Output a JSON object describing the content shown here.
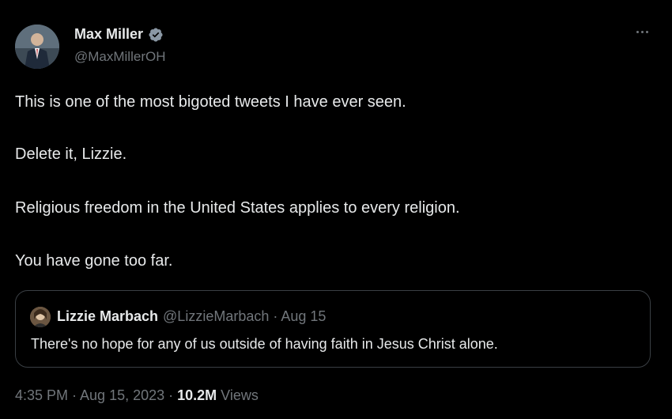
{
  "author": {
    "display_name": "Max Miller",
    "handle": "@MaxMillerOH",
    "verified": true
  },
  "tweet": {
    "paragraphs": [
      "This is one of the most bigoted tweets I have ever seen.",
      "Delete it, Lizzie.",
      "Religious freedom in the United States applies to every religion.",
      "You have gone too far."
    ]
  },
  "quoted_tweet": {
    "display_name": "Lizzie Marbach",
    "handle_and_date": "@LizzieMarbach · Aug 15",
    "text": "There's no hope for any of us outside of having faith in Jesus Christ alone."
  },
  "footer": {
    "timestamp": "4:35 PM · Aug 15, 2023 ·",
    "views_count": "10.2M",
    "views_label": "Views"
  },
  "colors": {
    "background": "#000000",
    "primary_text": "#e7e9ea",
    "secondary_text": "#71767b",
    "verified_badge": "#8b98a5"
  },
  "icons": {
    "verified": "verified-badge-icon",
    "more": "more-options-icon"
  }
}
